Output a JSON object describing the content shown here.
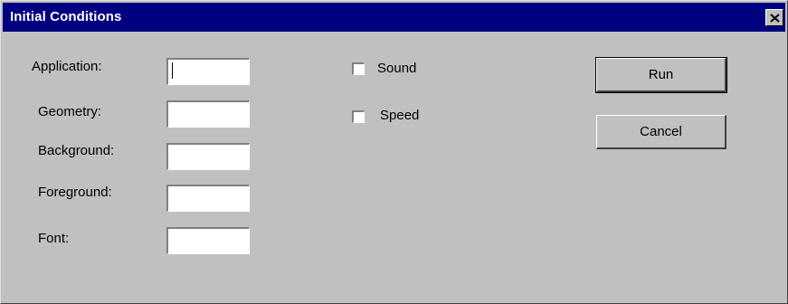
{
  "window": {
    "title": "Initial Conditions",
    "close_icon": "close-icon"
  },
  "fields": [
    {
      "label": "Application:",
      "value": ""
    },
    {
      "label": "Geometry:",
      "value": ""
    },
    {
      "label": "Background:",
      "value": ""
    },
    {
      "label": "Foreground:",
      "value": ""
    },
    {
      "label": "Font:",
      "value": ""
    }
  ],
  "options": [
    {
      "label": "Sound",
      "checked": false
    },
    {
      "label": "Speed",
      "checked": false
    }
  ],
  "buttons": {
    "run": "Run",
    "cancel": "Cancel"
  },
  "colors": {
    "titlebar": "#000080",
    "face": "#c0c0c0"
  }
}
